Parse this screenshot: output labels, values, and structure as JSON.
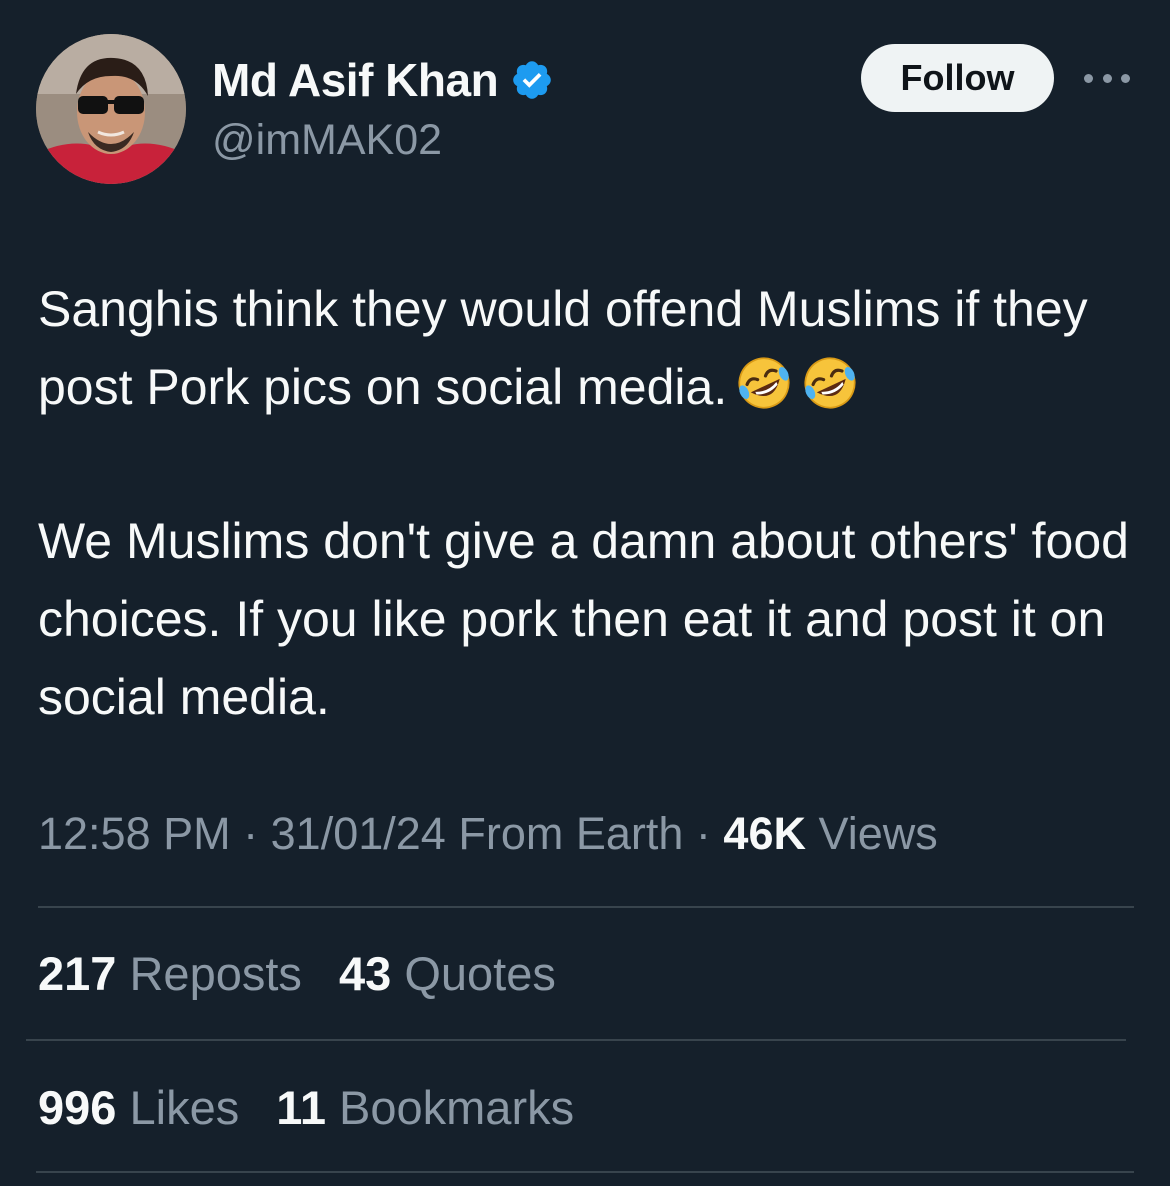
{
  "author": {
    "display_name": "Md Asif Khan",
    "handle": "@imMAK02",
    "verified": true,
    "follow_label": "Follow"
  },
  "tweet": {
    "paragraph_1": "Sanghis think they would offend Muslims if they post Pork pics on social media.",
    "paragraph_2": "We Muslims don't give a damn about others' food choices. If you like pork then eat it and post it on social media.",
    "emoji": [
      "rolling-on-floor-laughing",
      "rolling-on-floor-laughing"
    ]
  },
  "meta": {
    "time": "12:58 PM",
    "separator": "·",
    "date": "31/01/24",
    "source": "From Earth",
    "views_count": "46K",
    "views_label": "Views"
  },
  "stats": {
    "reposts_count": "217",
    "reposts_label": "Reposts",
    "quotes_count": "43",
    "quotes_label": "Quotes",
    "likes_count": "996",
    "likes_label": "Likes",
    "bookmarks_count": "11",
    "bookmarks_label": "Bookmarks"
  },
  "colors": {
    "background": "#15202b",
    "text_primary": "#f7f9f9",
    "text_secondary": "#8b98a5",
    "divider": "#38444d",
    "verified_blue": "#1d9bf0",
    "follow_button_bg": "#eff3f4"
  }
}
